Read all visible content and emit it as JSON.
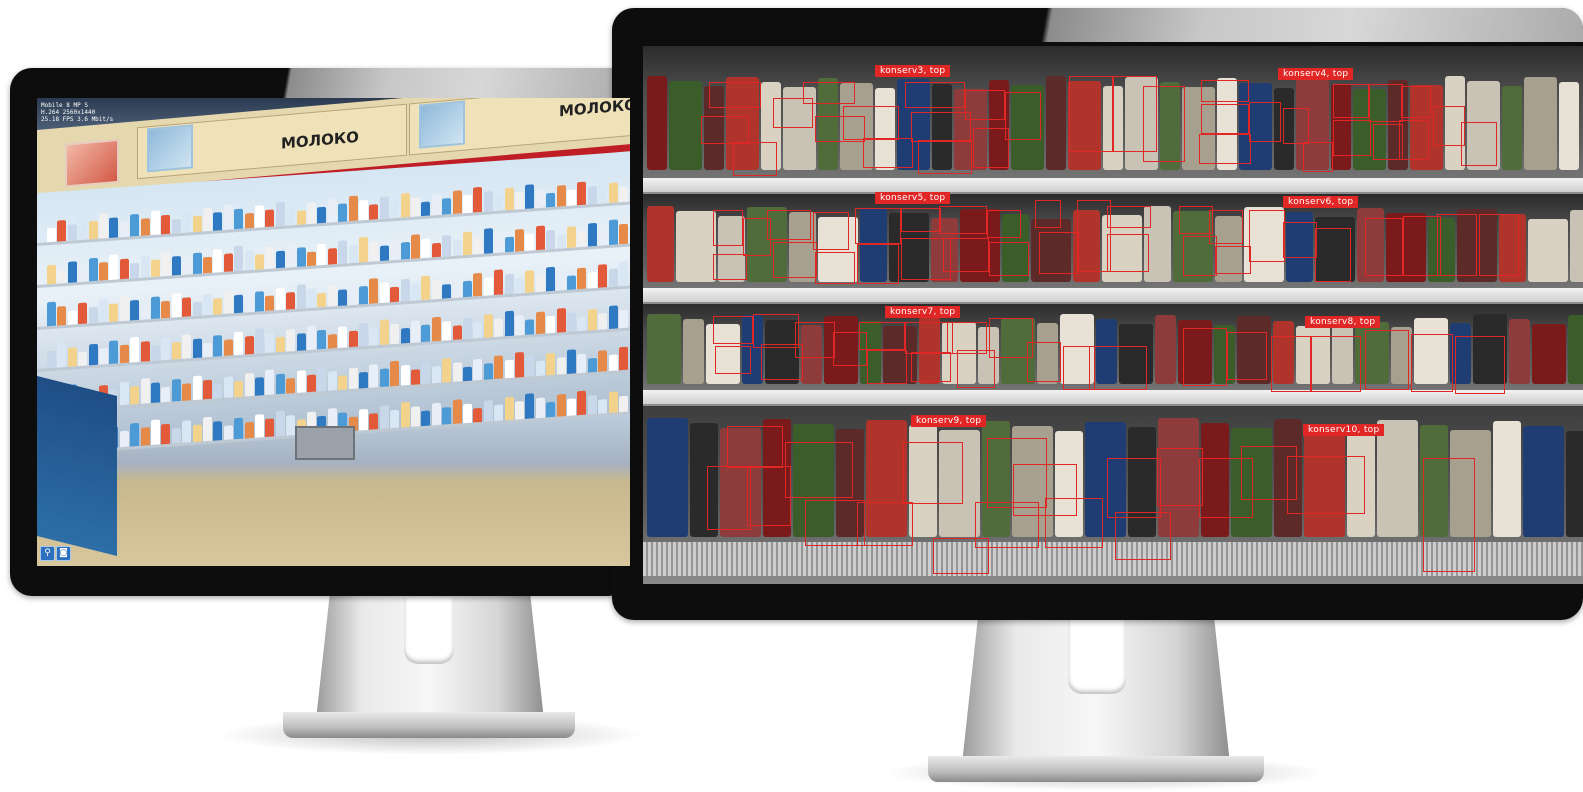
{
  "left_monitor": {
    "overlay_lines": [
      "Mobile 8 MP S",
      "H.264 2560x1440",
      "25.18 FPS 3.6 Mbit/s"
    ],
    "signs": [
      "МОЛОКО",
      "МОЛОКО"
    ],
    "buttons": [
      {
        "icon": "person-icon",
        "glyph": "⚲"
      },
      {
        "icon": "camera-icon",
        "glyph": "◙"
      }
    ]
  },
  "right_monitor": {
    "labels": [
      {
        "text": "konserv3, top"
      },
      {
        "text": "konserv4, top"
      },
      {
        "text": "konserv5, top"
      },
      {
        "text": "konserv6, top"
      },
      {
        "text": "konserv7, top"
      },
      {
        "text": "konserv8, top"
      },
      {
        "text": "konserv9, top"
      },
      {
        "text": "konserv10, top"
      }
    ]
  },
  "colors": {
    "detection_red": "#e12626",
    "bezel": "#0d0d0d",
    "sign_red_stripe": "#c01e27"
  }
}
